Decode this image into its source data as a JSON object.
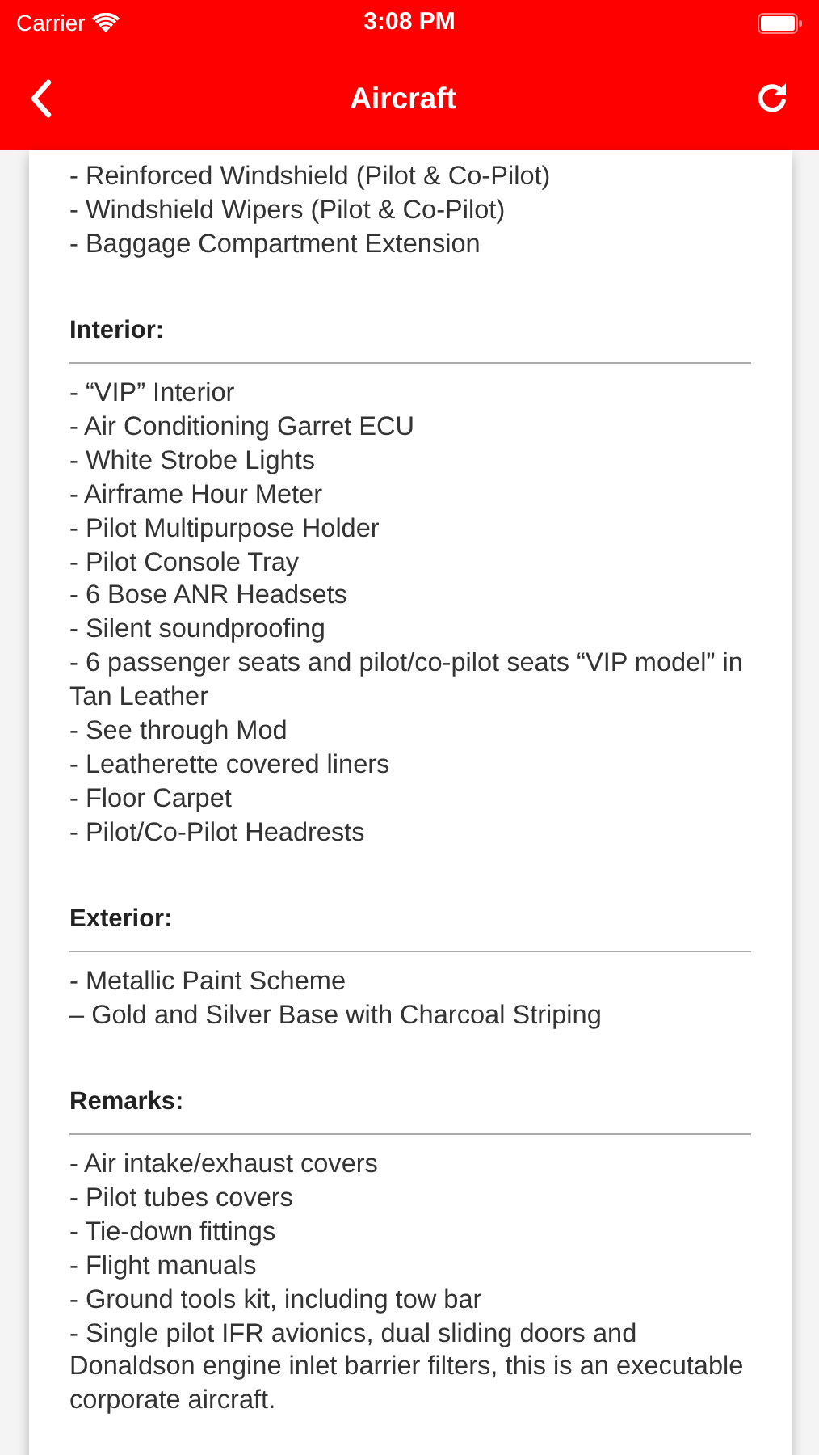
{
  "status_bar": {
    "carrier": "Carrier",
    "time": "3:08 PM"
  },
  "nav_bar": {
    "title": "Aircraft"
  },
  "sections": [
    {
      "items": [
        "- Reinforced Windshield (Pilot & Co-Pilot)",
        "- Windshield Wipers (Pilot & Co-Pilot)",
        "- Baggage Compartment Extension"
      ]
    },
    {
      "heading": "Interior:",
      "items": [
        "- “VIP” Interior",
        "- Air Conditioning Garret ECU",
        "- White Strobe Lights",
        "- Airframe Hour Meter",
        "- Pilot Multipurpose Holder",
        "- Pilot Console Tray",
        "- 6 Bose ANR Headsets",
        "- Silent soundproofing",
        "- 6 passenger seats and pilot/co-pilot seats “VIP model” in Tan Leather",
        "- See through Mod",
        "- Leatherette covered liners",
        "- Floor Carpet",
        "- Pilot/Co-Pilot Headrests"
      ]
    },
    {
      "heading": "Exterior:",
      "items": [
        "- Metallic Paint Scheme",
        "– Gold and Silver Base with Charcoal Striping"
      ]
    },
    {
      "heading": "Remarks:",
      "items": [
        "- Air intake/exhaust covers",
        "- Pilot tubes covers",
        "- Tie-down fittings",
        "- Flight manuals",
        "- Ground tools kit, including tow bar",
        "- Single pilot IFR avionics, dual sliding doors and Donaldson engine inlet barrier filters, this is an executable corporate aircraft."
      ]
    }
  ]
}
